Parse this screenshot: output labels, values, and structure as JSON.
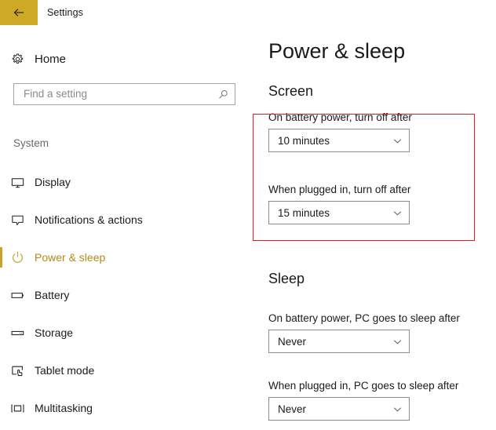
{
  "window": {
    "titlebar": {
      "title": "Settings",
      "back_icon": "back-arrow-icon",
      "accent_color": "#cfa826"
    }
  },
  "sidebar": {
    "home": {
      "label": "Home",
      "icon": "gear-icon"
    },
    "search": {
      "value": "",
      "placeholder": "Find a setting",
      "icon": "search-icon"
    },
    "group_title": "System",
    "items": [
      {
        "label": "Display",
        "icon": "monitor-icon",
        "selected": false
      },
      {
        "label": "Notifications & actions",
        "icon": "speech-bubble-icon",
        "selected": false
      },
      {
        "label": "Power & sleep",
        "icon": "power-icon",
        "selected": true
      },
      {
        "label": "Battery",
        "icon": "battery-icon",
        "selected": false
      },
      {
        "label": "Storage",
        "icon": "drive-icon",
        "selected": false
      },
      {
        "label": "Tablet mode",
        "icon": "tablet-hand-icon",
        "selected": false
      },
      {
        "label": "Multitasking",
        "icon": "multitasking-icon",
        "selected": false
      }
    ],
    "selected_accent_color": "#c9a227",
    "selected_text_color": "#b08d16"
  },
  "main": {
    "page_title": "Power & sleep",
    "sections": [
      {
        "heading": "Screen",
        "fields": [
          {
            "label": "On battery power, turn off after",
            "value": "10 minutes",
            "chevron": "chevron-down-icon"
          },
          {
            "label": "When plugged in, turn off after",
            "value": "15 minutes",
            "chevron": "chevron-down-icon"
          }
        ]
      },
      {
        "heading": "Sleep",
        "fields": [
          {
            "label": "On battery power, PC goes to sleep after",
            "value": "Never",
            "chevron": "chevron-down-icon"
          },
          {
            "label": "When plugged in, PC goes to sleep after",
            "value": "Never",
            "chevron": "chevron-down-icon"
          }
        ]
      }
    ]
  },
  "annotation": {
    "type": "rectangle-highlight",
    "color": "#e02020",
    "targets": "Screen turn-off-after dropdowns"
  }
}
